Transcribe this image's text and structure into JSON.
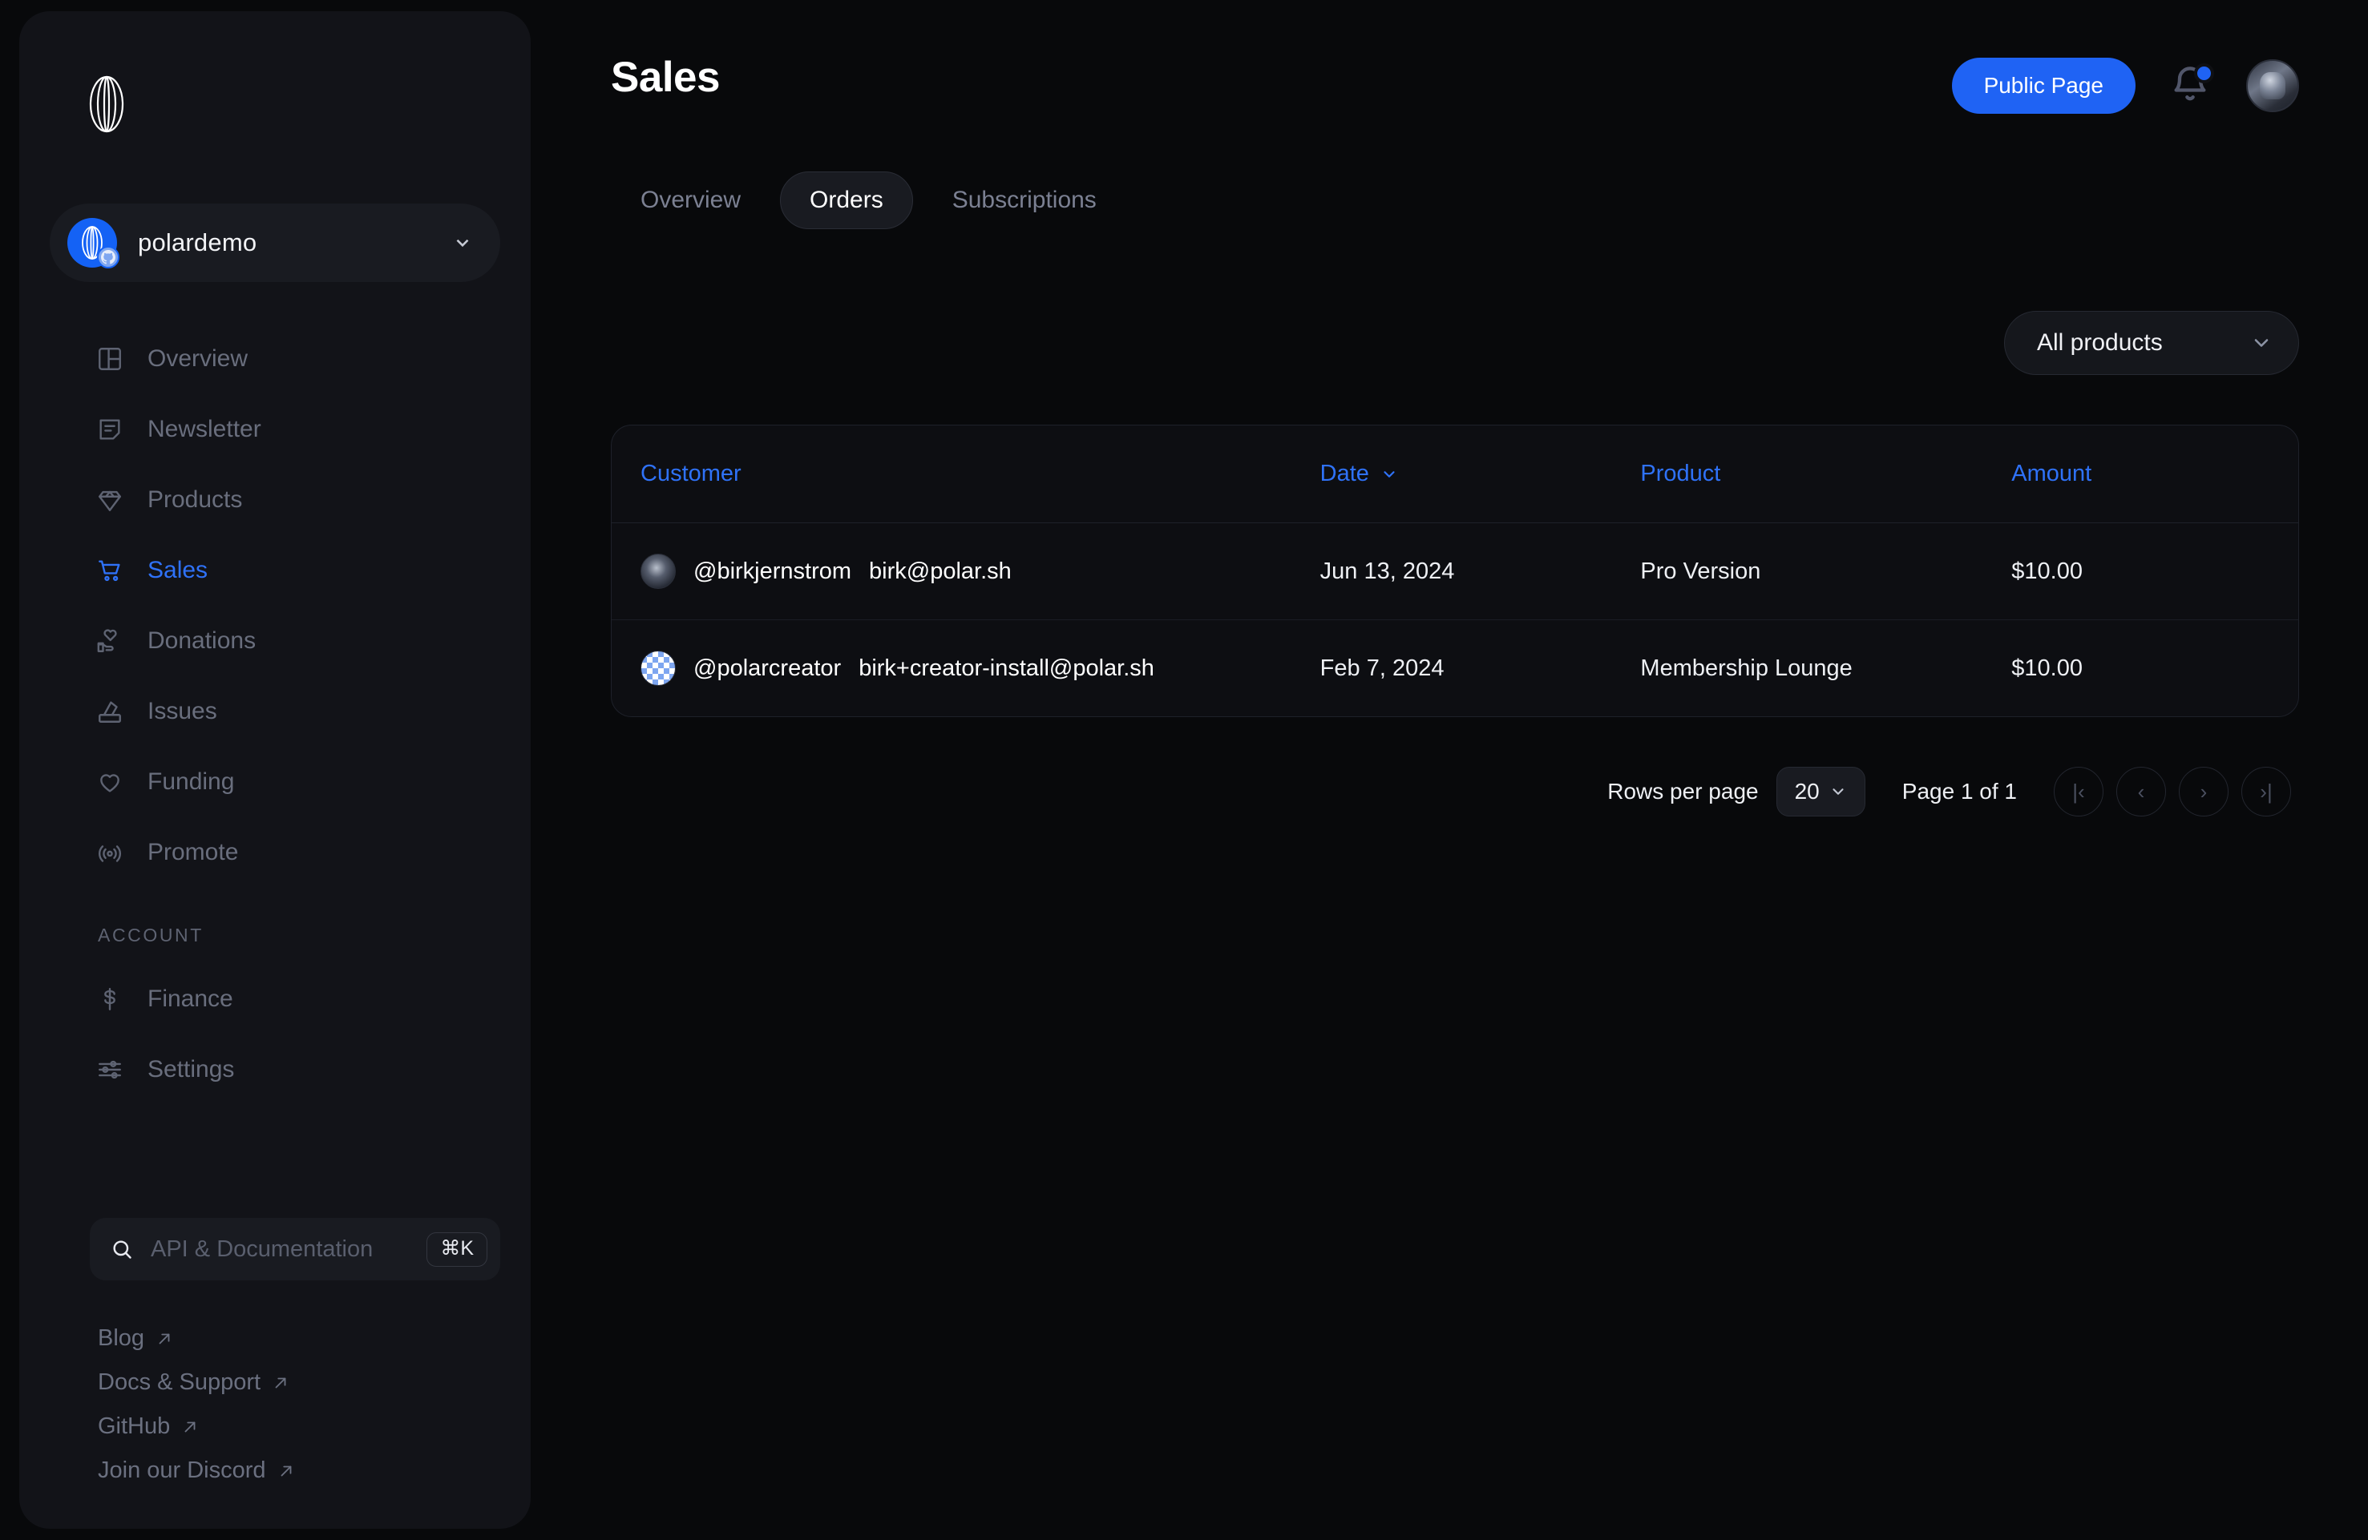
{
  "brand": {
    "accent": "#2f72f8",
    "button_blue": "#1f63f4",
    "logo_name": "polar-logo"
  },
  "sidebar": {
    "org": {
      "name": "polardemo",
      "avatar_icon": "polar-avatar",
      "badge_icon": "github-icon",
      "chevron_icon": "chevron-down-icon"
    },
    "nav": [
      {
        "label": "Overview",
        "icon": "layout-panel-icon",
        "active": false
      },
      {
        "label": "Newsletter",
        "icon": "note-icon",
        "active": false
      },
      {
        "label": "Products",
        "icon": "diamond-icon",
        "active": false
      },
      {
        "label": "Sales",
        "icon": "shopping-cart-icon",
        "active": true
      },
      {
        "label": "Donations",
        "icon": "hand-heart-icon",
        "active": false
      },
      {
        "label": "Issues",
        "icon": "ballot-box-icon",
        "active": false
      },
      {
        "label": "Funding",
        "icon": "heart-icon",
        "active": false
      },
      {
        "label": "Promote",
        "icon": "broadcast-icon",
        "active": false
      }
    ],
    "account_section_label": "ACCOUNT",
    "account_nav": [
      {
        "label": "Finance",
        "icon": "dollar-icon",
        "active": false
      },
      {
        "label": "Settings",
        "icon": "sliders-icon",
        "active": false
      }
    ],
    "search": {
      "placeholder": "API & Documentation",
      "shortcut": "⌘K",
      "icon": "search-icon"
    },
    "footer_links": [
      {
        "label": "Blog",
        "icon": "external-link-icon"
      },
      {
        "label": "Docs & Support",
        "icon": "external-link-icon"
      },
      {
        "label": "GitHub",
        "icon": "external-link-icon"
      },
      {
        "label": "Join our Discord",
        "icon": "external-link-icon"
      }
    ]
  },
  "header": {
    "title": "Sales",
    "public_page_label": "Public Page",
    "bell_icon": "notification-bell-icon",
    "has_notification": true,
    "avatar_icon": "user-avatar"
  },
  "tabs": [
    {
      "label": "Overview",
      "active": false
    },
    {
      "label": "Orders",
      "active": true
    },
    {
      "label": "Subscriptions",
      "active": false
    }
  ],
  "filter": {
    "label": "All products",
    "chevron_icon": "chevron-down-icon"
  },
  "table": {
    "columns": [
      {
        "label": "Customer",
        "sortable": false
      },
      {
        "label": "Date",
        "sortable": true,
        "sort_icon": "chevron-down-icon"
      },
      {
        "label": "Product",
        "sortable": false
      },
      {
        "label": "Amount",
        "sortable": false
      }
    ],
    "rows": [
      {
        "handle": "@birkjernstrom",
        "email": "birk@polar.sh",
        "avatar_kind": "photo",
        "date": "Jun 13, 2024",
        "product": "Pro Version",
        "amount": "$10.00"
      },
      {
        "handle": "@polarcreator",
        "email": "birk+creator-install@polar.sh",
        "avatar_kind": "checker",
        "date": "Feb 7, 2024",
        "product": "Membership Lounge",
        "amount": "$10.00"
      }
    ]
  },
  "pagination": {
    "rows_per_page_label": "Rows per page",
    "rows_per_page_value": "20",
    "page_status": "Page 1 of 1",
    "buttons": [
      {
        "name": "first-page",
        "glyph": "|‹"
      },
      {
        "name": "prev-page",
        "glyph": "‹"
      },
      {
        "name": "next-page",
        "glyph": "›"
      },
      {
        "name": "last-page",
        "glyph": "›|"
      }
    ]
  }
}
